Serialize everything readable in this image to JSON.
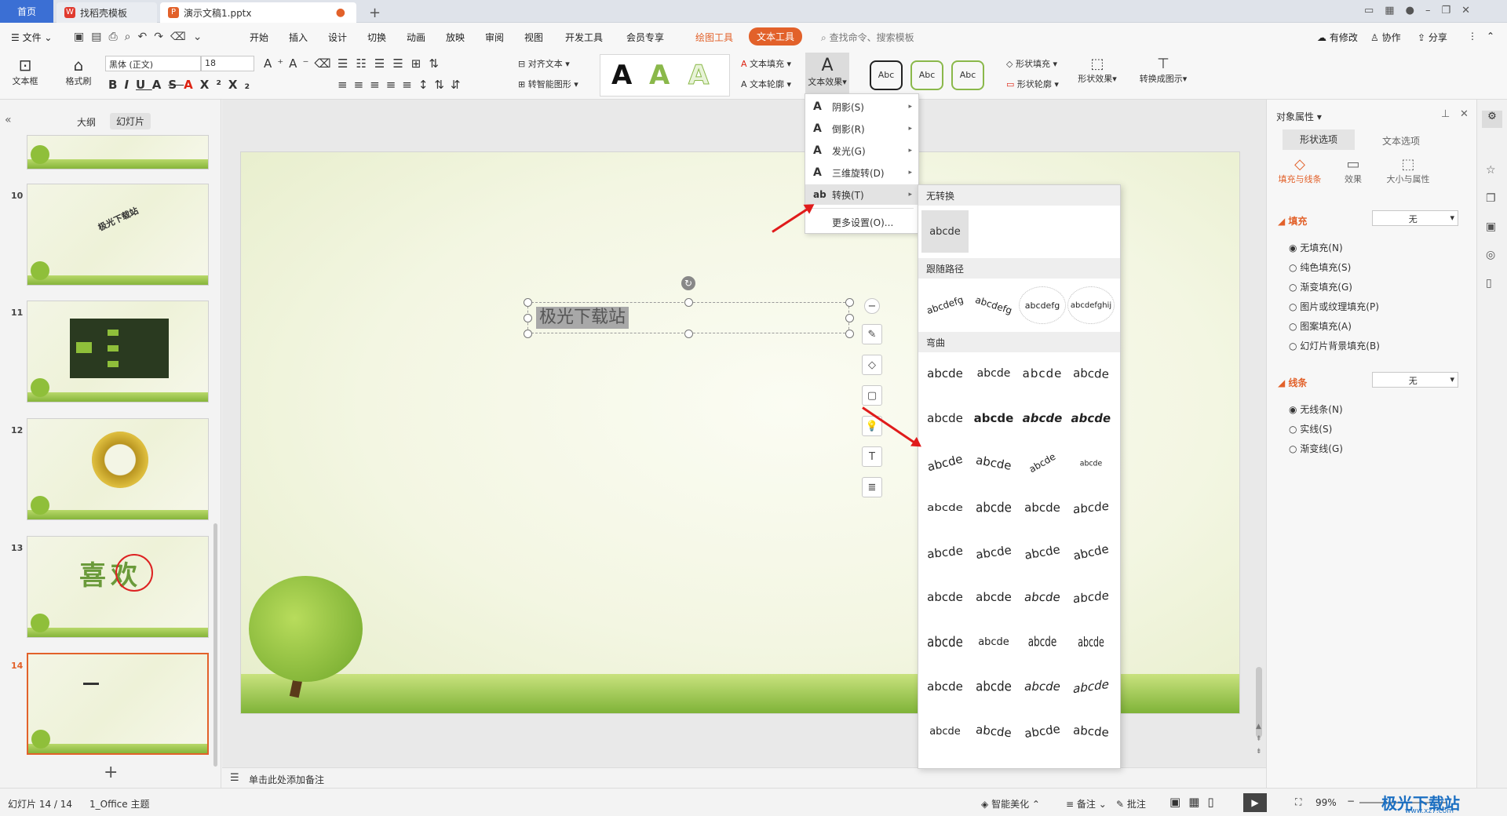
{
  "tabs": {
    "home": "首页",
    "templates": "找稻壳模板",
    "document": "演示文稿1.pptx",
    "new_tab": "+"
  },
  "menu": {
    "file": "文件",
    "items": [
      "开始",
      "插入",
      "设计",
      "切换",
      "动画",
      "放映",
      "审阅",
      "视图",
      "开发工具",
      "会员专享"
    ],
    "drawing_tools": "绘图工具",
    "text_tools": "文本工具",
    "search_placeholder": "查找命令、搜索模板",
    "modified": "有修改",
    "collab": "协作",
    "share": "分享"
  },
  "toolbar": {
    "textbox": "文本框",
    "format_painter": "格式刷",
    "font": "黑体 (正文)",
    "size": "18",
    "align_text": "对齐文本",
    "smart_graphic": "转智能图形",
    "text_fill": "文本填充",
    "text_outline": "文本轮廓",
    "text_effect": "文本效果",
    "shape_fill": "形状填充",
    "shape_outline": "形状轮廓",
    "shape_effect": "形状效果",
    "convert_graphic": "转换成图示",
    "style_letters": [
      "A",
      "A",
      "A"
    ],
    "shape_styles": [
      "Abc",
      "Abc",
      "Abc"
    ]
  },
  "left_panel": {
    "tab_outline": "大纲",
    "tab_slides": "幻灯片",
    "slide_numbers": [
      "10",
      "11",
      "12",
      "13",
      "14"
    ],
    "thumb10_text": "极光下载站",
    "thumb13_text": "喜欢",
    "add": "+"
  },
  "slide": {
    "selected_text": "极光下载站"
  },
  "notes": {
    "placeholder": "单击此处添加备注"
  },
  "dropdown": {
    "items": [
      {
        "label": "阴影(S)",
        "icon": "A"
      },
      {
        "label": "倒影(R)",
        "icon": "A"
      },
      {
        "label": "发光(G)",
        "icon": "A"
      },
      {
        "label": "三维旋转(D)",
        "icon": "A"
      },
      {
        "label": "转换(T)",
        "icon": "ab"
      }
    ],
    "more": "更多设置(O)..."
  },
  "submenu": {
    "no_transform": "无转换",
    "none_sample": "abcde",
    "follow_path": "跟随路径",
    "path_samples": [
      "abcdefg",
      "abcdefg",
      "abcdefg",
      "abcdefghij"
    ],
    "warp": "弯曲",
    "warp_sample": "abcde"
  },
  "right_panel": {
    "title": "对象属性",
    "tab_shape": "形状选项",
    "tab_text": "文本选项",
    "sub_fill_line": "填充与线条",
    "sub_effect": "效果",
    "sub_size": "大小与属性",
    "fill_label": "填充",
    "fill_value": "无",
    "fill_options": [
      "无填充(N)",
      "纯色填充(S)",
      "渐变填充(G)",
      "图片或纹理填充(P)",
      "图案填充(A)",
      "幻灯片背景填充(B)"
    ],
    "line_label": "线条",
    "line_value": "无",
    "line_options": [
      "无线条(N)",
      "实线(S)",
      "渐变线(G)"
    ]
  },
  "status": {
    "slide_info": "幻灯片 14 / 14",
    "theme": "1_Office 主题",
    "smart_beautify": "智能美化",
    "notes": "备注",
    "comments": "批注",
    "zoom": "99%",
    "watermark": "极光下载站",
    "watermark_url": "www.xz7.com"
  },
  "colors": {
    "accent": "#e2612a",
    "tab_blue": "#3b6fd4",
    "arrow": "#e01b1b"
  }
}
